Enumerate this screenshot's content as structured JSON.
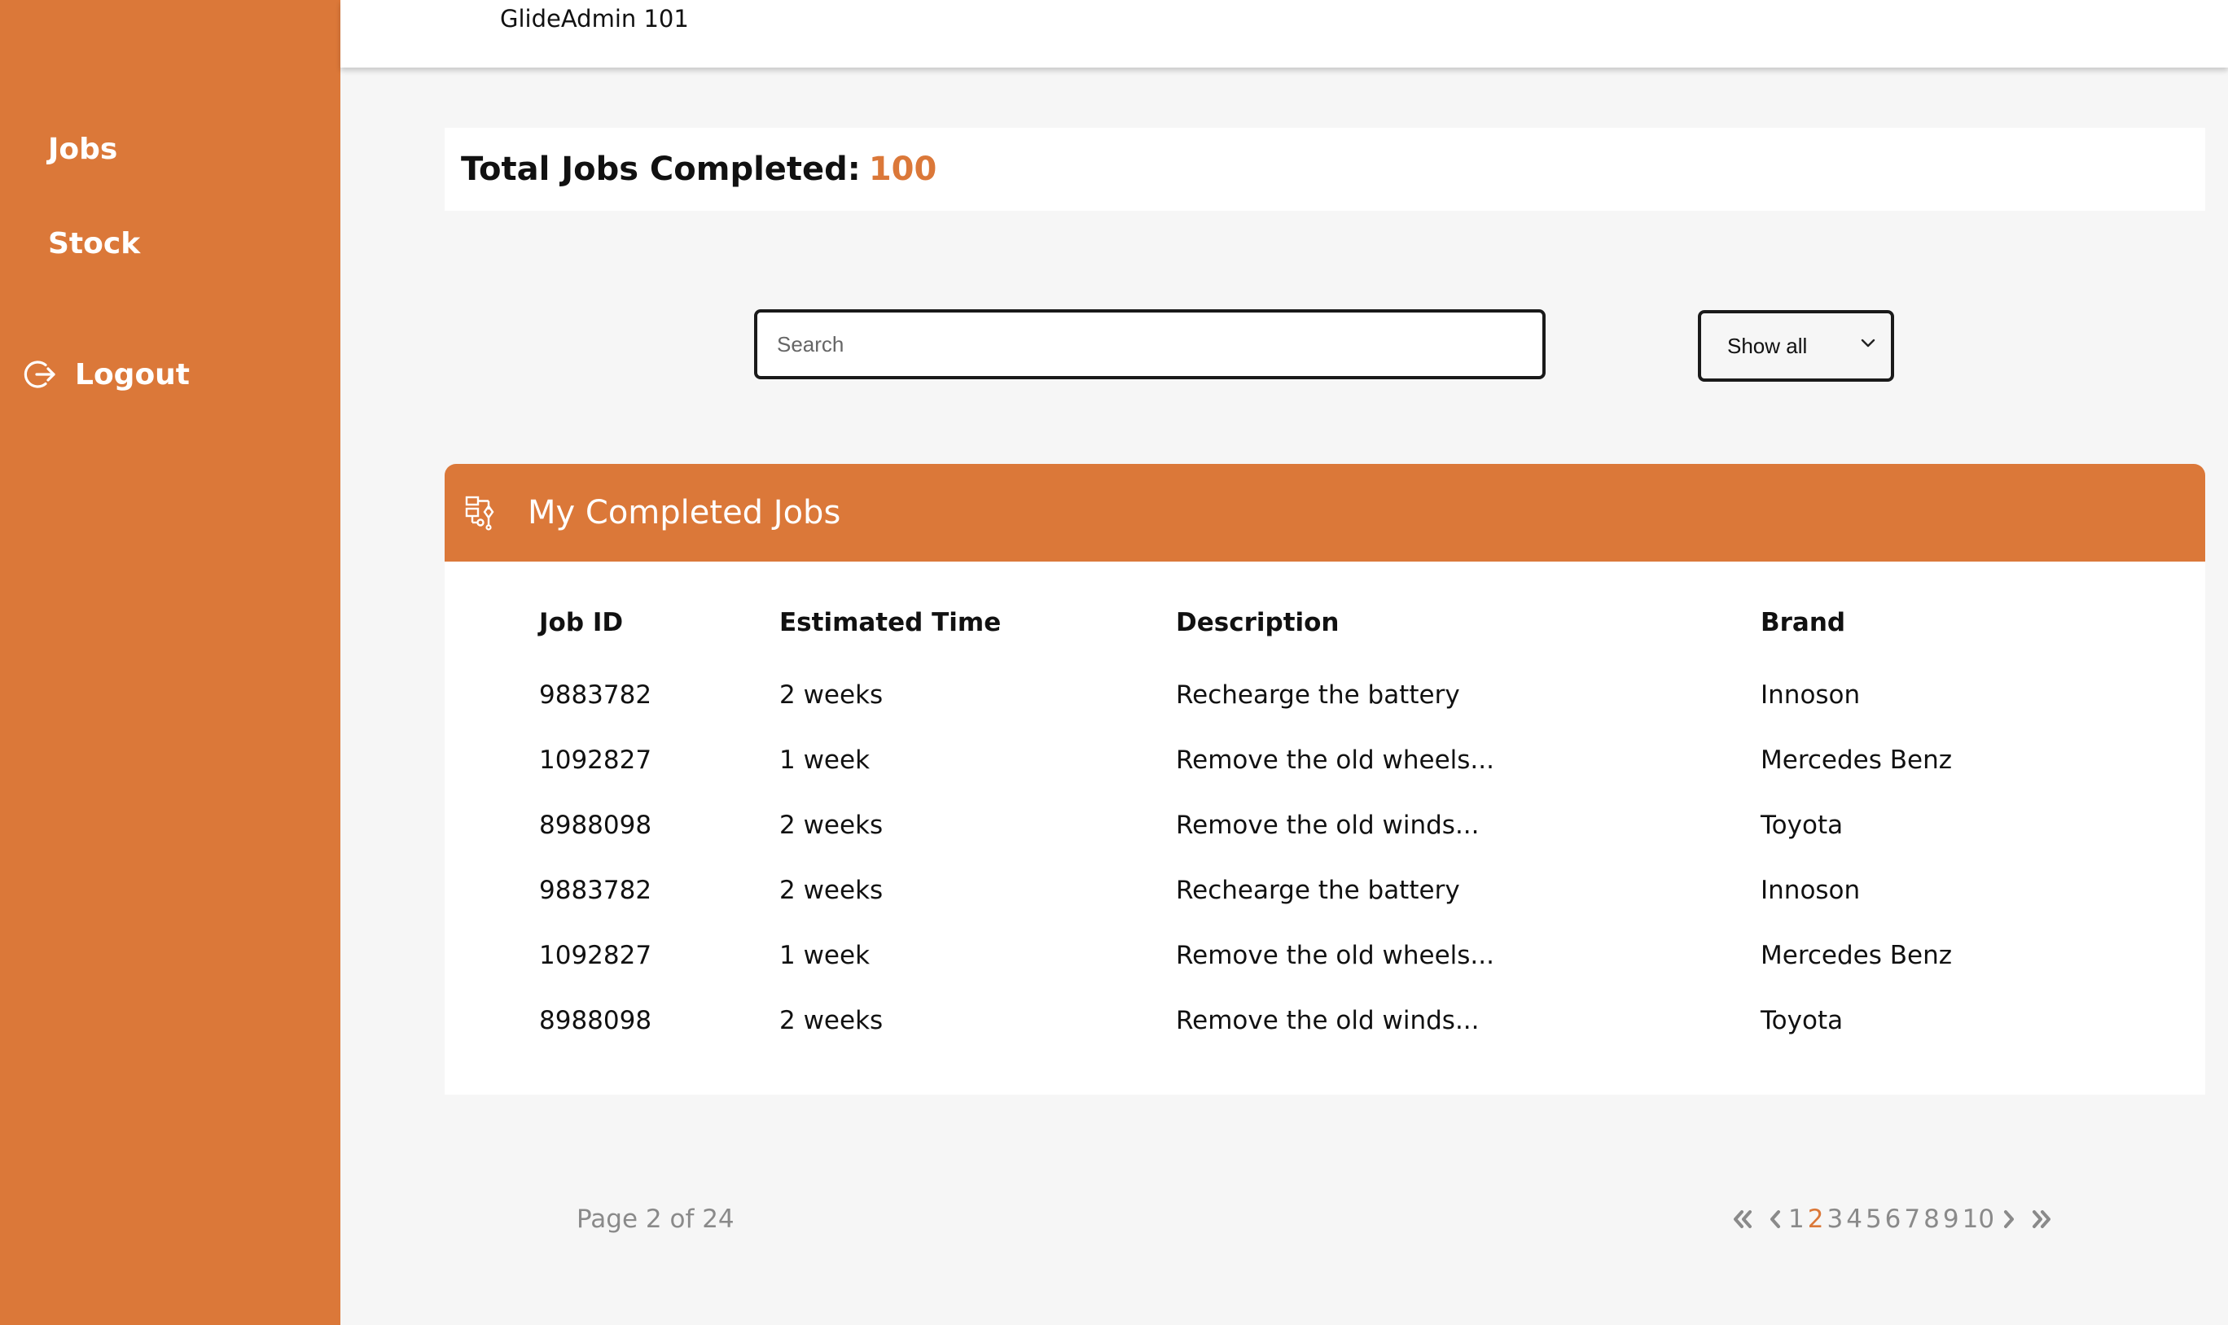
{
  "app": {
    "title": "GlideAdmin 101"
  },
  "sidebar": {
    "items": [
      {
        "label": "Jobs"
      },
      {
        "label": "Stock"
      }
    ],
    "logout_label": "Logout"
  },
  "summary": {
    "label": "Total Jobs Completed:",
    "value": "100"
  },
  "search": {
    "placeholder": "Search",
    "value": ""
  },
  "filter": {
    "selected": "Show all"
  },
  "jobs": {
    "title": "My Completed Jobs",
    "columns": [
      "Job ID",
      "Estimated Time",
      "Description",
      "Brand"
    ],
    "rows": [
      [
        "9883782",
        "2 weeks",
        "Rechearge the battery",
        "Innoson"
      ],
      [
        "1092827",
        "1 week",
        "Remove the old wheels...",
        "Mercedes Benz"
      ],
      [
        "8988098",
        "2 weeks",
        "Remove the old winds...",
        "Toyota"
      ],
      [
        "9883782",
        "2 weeks",
        "Rechearge the battery",
        "Innoson"
      ],
      [
        "1092827",
        "1 week",
        "Remove the old wheels...",
        "Mercedes Benz"
      ],
      [
        "8988098",
        "2 weeks",
        "Remove the old winds...",
        "Toyota"
      ]
    ]
  },
  "pagination": {
    "info": "Page 2 of 24",
    "pages": [
      "1",
      "2",
      "3",
      "4",
      "5",
      "6",
      "7",
      "8",
      "9",
      "10"
    ],
    "current": "2"
  },
  "colors": {
    "accent": "#db7839",
    "background": "#f6f6f6",
    "card": "#ffffff"
  },
  "icons": {
    "logout": "logout-icon",
    "jobs_header": "workflow-icon",
    "first": "double-chevron-left-icon",
    "prev": "chevron-left-icon",
    "next": "chevron-right-icon",
    "last": "double-chevron-right-icon"
  }
}
